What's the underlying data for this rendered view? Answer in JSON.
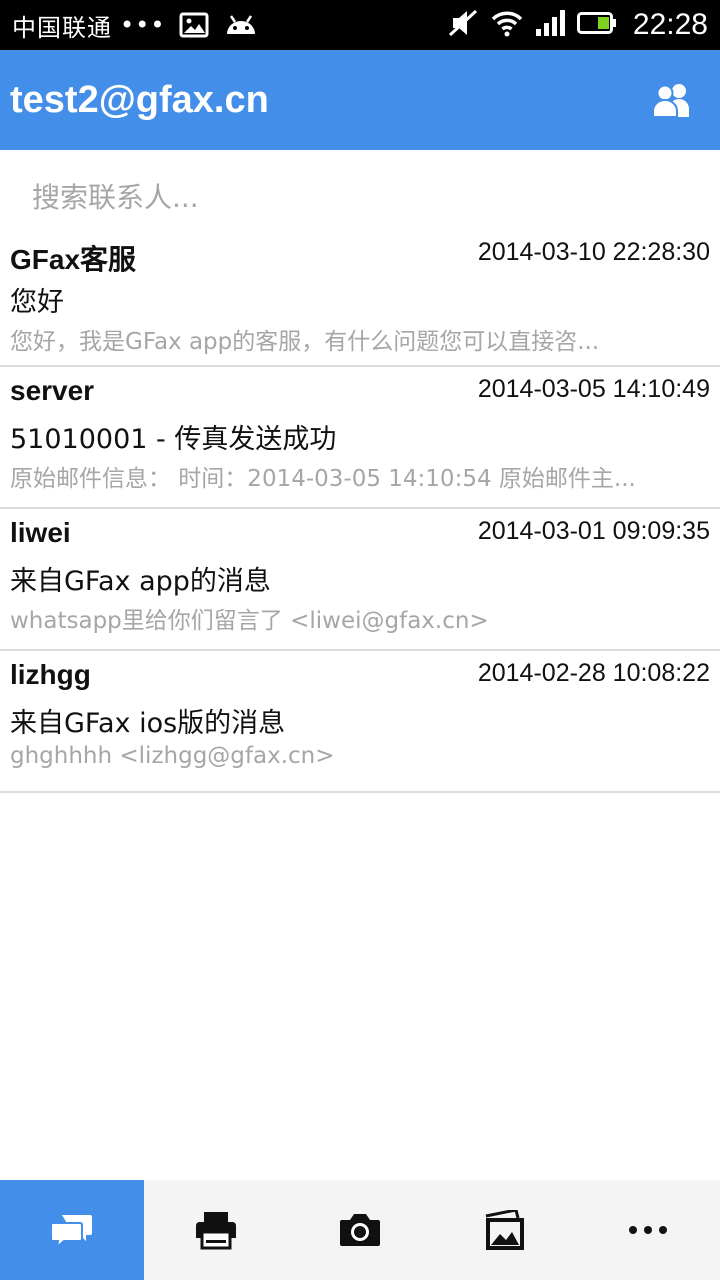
{
  "status_bar": {
    "carrier": "中国联通",
    "dots": "•••",
    "time": "22:28",
    "icons": [
      "image-icon",
      "android-icon",
      "mute-icon",
      "wifi-icon",
      "signal-icon",
      "battery-icon"
    ]
  },
  "app_bar": {
    "title": "test2@gfax.cn",
    "contacts_icon": "contacts-icon"
  },
  "search": {
    "placeholder": "搜索联系人..."
  },
  "messages": [
    {
      "sender": "GFax客服",
      "time": "2014-03-10 22:28:30",
      "subject": "您好",
      "preview": "您好，我是GFax app的客服，有什么问题您可以直接咨..."
    },
    {
      "sender": "server",
      "time": "2014-03-05 14:10:49",
      "subject": "51010001 - 传真发送成功",
      "preview": "原始邮件信息： 时间：2014-03-05 14:10:54 原始邮件主..."
    },
    {
      "sender": "liwei",
      "time": "2014-03-01 09:09:35",
      "subject": "来自GFax app的消息",
      "preview": "whatsapp里给你们留言了 <liwei@gfax.cn>"
    },
    {
      "sender": "lizhgg",
      "time": "2014-02-28 10:08:22",
      "subject": "来自GFax ios版的消息",
      "preview": "ghghhhh <lizhgg@gfax.cn>"
    }
  ],
  "bottom_nav": {
    "tabs": [
      "messages-icon",
      "fax-icon",
      "camera-icon",
      "gallery-icon",
      "more-icon"
    ],
    "active": "messages-icon"
  },
  "colors": {
    "accent": "#428ee8",
    "status_bar": "#000000",
    "battery_fill": "#7ed321"
  }
}
